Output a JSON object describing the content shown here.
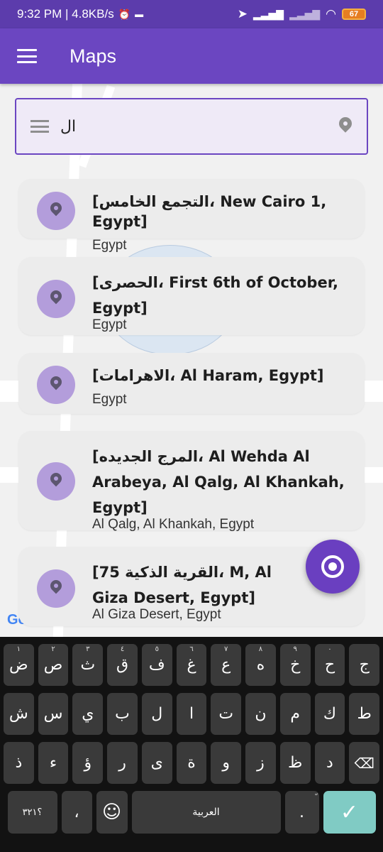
{
  "status_bar": {
    "time_speed": "9:32 PM | 4.8KB/s",
    "battery": "67"
  },
  "app_bar": {
    "title": "Maps"
  },
  "search": {
    "value": "ال"
  },
  "results": [
    {
      "title": "[التجمع الخامس، New Cairo 1,  Egypt]",
      "subtitle": "Egypt"
    },
    {
      "title": "[الحصرى، First 6th of October, Egypt]",
      "subtitle": "Egypt"
    },
    {
      "title": "[الاهرامات، Al Haram,  Egypt]",
      "subtitle": "Egypt"
    },
    {
      "title": "[المرج الجديده، Al Wehda Al Arabeya,  Al Qalg,  Al Khankah, Egypt]",
      "subtitle": "Al Qalg, Al Khankah, Egypt"
    },
    {
      "title": "[75 القرية الذكية، M,  Al Giza Desert, Egypt]",
      "subtitle": "Al Giza Desert, Egypt"
    }
  ],
  "map": {
    "logo_text": "Go"
  },
  "keyboard": {
    "row1": [
      {
        "ch": "ض",
        "hint": "١"
      },
      {
        "ch": "ص",
        "hint": "٢"
      },
      {
        "ch": "ث",
        "hint": "٣"
      },
      {
        "ch": "ق",
        "hint": "٤"
      },
      {
        "ch": "ف",
        "hint": "٥"
      },
      {
        "ch": "غ",
        "hint": "٦"
      },
      {
        "ch": "ع",
        "hint": "٧"
      },
      {
        "ch": "ه",
        "hint": "٨"
      },
      {
        "ch": "خ",
        "hint": "٩"
      },
      {
        "ch": "ح",
        "hint": "٠"
      },
      {
        "ch": "ج",
        "hint": ""
      }
    ],
    "row2": [
      "ش",
      "س",
      "ي",
      "ب",
      "ل",
      "ا",
      "ت",
      "ن",
      "م",
      "ك",
      "ط"
    ],
    "row3": [
      "ذ",
      "ء",
      "ؤ",
      "ر",
      "ى",
      "ة",
      "و",
      "ز",
      "ظ",
      "د"
    ],
    "num_label": "؟٣٢١",
    "comma": "،",
    "space_label": "العربية",
    "dot": ".",
    "dot_hint": "ّ",
    "enter": "✓",
    "backspace": "⌫",
    "emoji": "☺"
  },
  "colors": {
    "app_bar": "#6b46c1",
    "status_bar": "#5c3cac",
    "fab": "#6a3fc0",
    "result_icon_bg": "#b39ddb",
    "enter_key": "#80cbc4"
  }
}
